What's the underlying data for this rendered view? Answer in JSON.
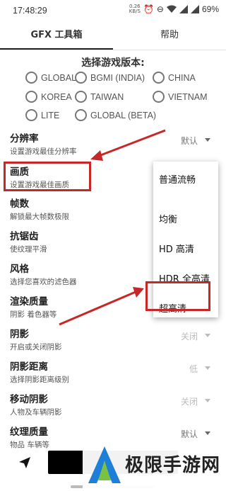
{
  "status": {
    "time": "17:48:29",
    "speed_top": "0.26",
    "speed_bottom": "KB/S",
    "network": "4G",
    "battery": "69%"
  },
  "tabs": [
    {
      "label": "GFX 工具箱",
      "active": true
    },
    {
      "label": "帮助",
      "active": false
    }
  ],
  "version": {
    "title": "选择游戏版本:",
    "options": [
      "GLOBAL",
      "BGMI (INDIA)",
      "CHINA",
      "KOREA",
      "TAIWAN",
      "VIETNAM",
      "LITE",
      "GLOBAL (BETA)"
    ]
  },
  "settings": [
    {
      "title": "分辨率",
      "desc": "设置游戏最佳分辨率",
      "value": "默认"
    },
    {
      "title": "画质",
      "desc": "设置游戏最佳画质",
      "value": ""
    },
    {
      "title": "帧数",
      "desc": "解锁最大帧数极限",
      "value": ""
    },
    {
      "title": "抗锯齿",
      "desc": "使纹理平滑",
      "value": ""
    },
    {
      "title": "风格",
      "desc": "选择您喜欢的滤色器",
      "value": ""
    },
    {
      "title": "渲染质量",
      "desc": "阴影 着色器等",
      "value": ""
    },
    {
      "title": "阴影",
      "desc": "开启或关闭阴影",
      "value": "关闭"
    },
    {
      "title": "阴影距离",
      "desc": "选择阴影距离级别",
      "value": "低"
    },
    {
      "title": "移动阴影",
      "desc": "人物及车辆阴影",
      "value": "关闭"
    },
    {
      "title": "纹理质量",
      "desc": "物品 车辆等",
      "value": "默认"
    }
  ],
  "dropdown": {
    "options": [
      "普通流畅",
      "均衡",
      "HD 高清",
      "HDR 全高清",
      "超高清"
    ]
  },
  "watermark": {
    "text": "极限手游网"
  },
  "colors": {
    "highlight": "#c62828"
  }
}
